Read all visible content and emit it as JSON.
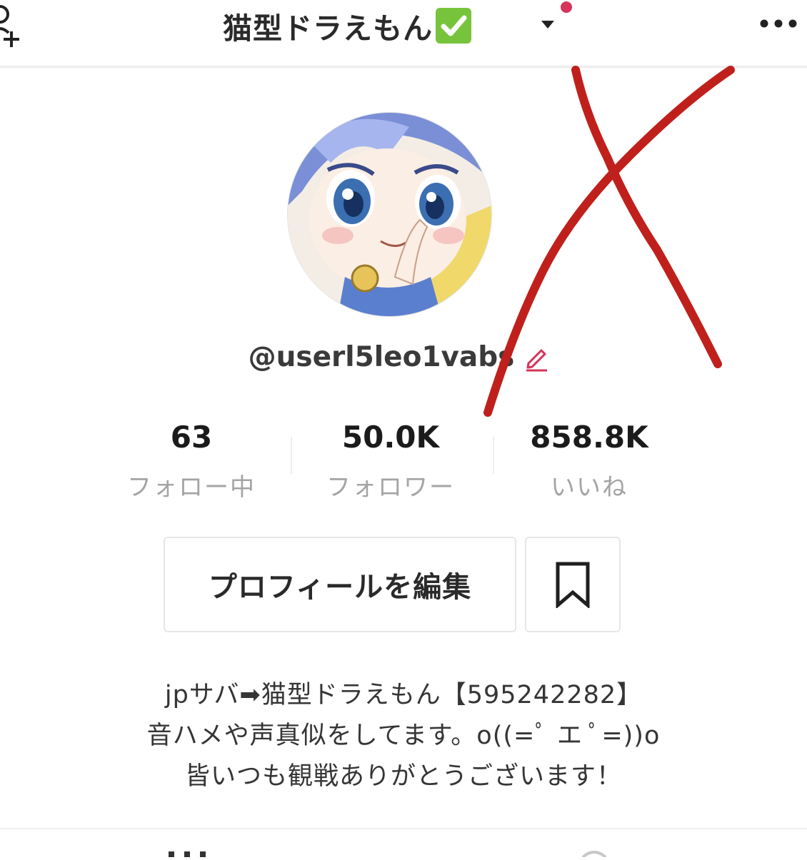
{
  "header": {
    "title": "猫型ドラえもん",
    "verified_mark": "✓"
  },
  "profile": {
    "username": "@userl5leo1vabs"
  },
  "stats": [
    {
      "value": "63",
      "label": "フォロー中"
    },
    {
      "value": "50.0K",
      "label": "フォロワー"
    },
    {
      "value": "858.8K",
      "label": "いいね"
    }
  ],
  "actions": {
    "edit_profile": "プロフィールを編集"
  },
  "bio": {
    "line1": "jpサバ➡猫型ドラえもん【595242282】",
    "line2": "音ハメや声真似をしてます。o((=ﾟ エ ﾟ=))o",
    "line3": "皆いつも観戦ありがとうございます！"
  },
  "colors": {
    "accent_red": "#c0201c",
    "verified_green": "#77c43c",
    "notification_pink": "#d6335a"
  },
  "icons": [
    "add-user-icon",
    "verified-check-icon",
    "chevron-down-icon",
    "more-icon",
    "edit-icon",
    "bookmark-icon"
  ]
}
